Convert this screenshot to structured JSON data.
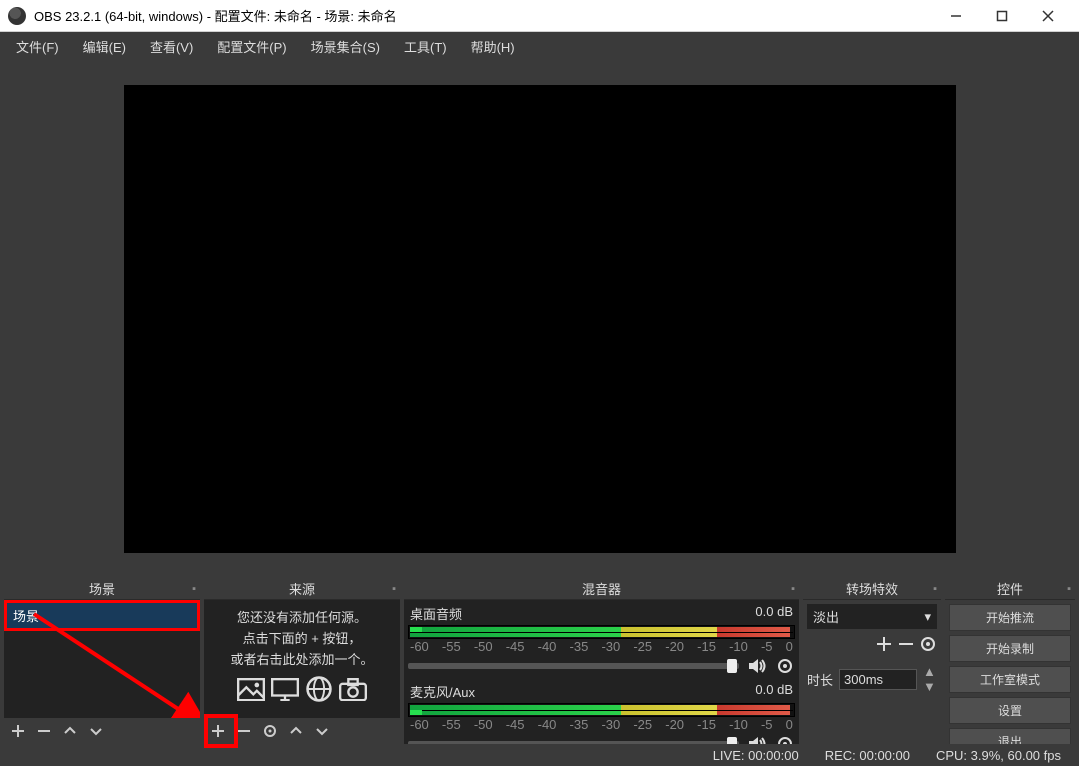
{
  "title": "OBS 23.2.1 (64-bit, windows) - 配置文件: 未命名 - 场景: 未命名",
  "menu": {
    "file": "文件(F)",
    "edit": "编辑(E)",
    "view": "查看(V)",
    "profile": "配置文件(P)",
    "scenes": "场景集合(S)",
    "tools": "工具(T)",
    "help": "帮助(H)"
  },
  "docks": {
    "scenes": {
      "title": "场景",
      "active": "场景"
    },
    "sources": {
      "title": "来源",
      "empty1": "您还没有添加任何源。",
      "empty2": "点击下面的 + 按钮，",
      "empty3": "或者右击此处添加一个。"
    },
    "mixer": {
      "title": "混音器",
      "ch1": {
        "name": "桌面音频",
        "db": "0.0 dB",
        "ticks": [
          "-60",
          "-55",
          "-50",
          "-45",
          "-40",
          "-35",
          "-30",
          "-25",
          "-20",
          "-15",
          "-10",
          "-5",
          "0"
        ]
      },
      "ch2": {
        "name": "麦克风/Aux",
        "db": "0.0 dB",
        "ticks": [
          "-60",
          "-55",
          "-50",
          "-45",
          "-40",
          "-35",
          "-30",
          "-25",
          "-20",
          "-15",
          "-10",
          "-5",
          "0"
        ]
      }
    },
    "trans": {
      "title": "转场特效",
      "selected": "淡出",
      "dur_label": "时长",
      "dur": "300ms"
    },
    "ctrl": {
      "title": "控件",
      "b1": "开始推流",
      "b2": "开始录制",
      "b3": "工作室模式",
      "b4": "设置",
      "b5": "退出"
    }
  },
  "status": {
    "live": "LIVE: 00:00:00",
    "rec": "REC: 00:00:00",
    "cpu": "CPU: 3.9%, 60.00 fps"
  }
}
